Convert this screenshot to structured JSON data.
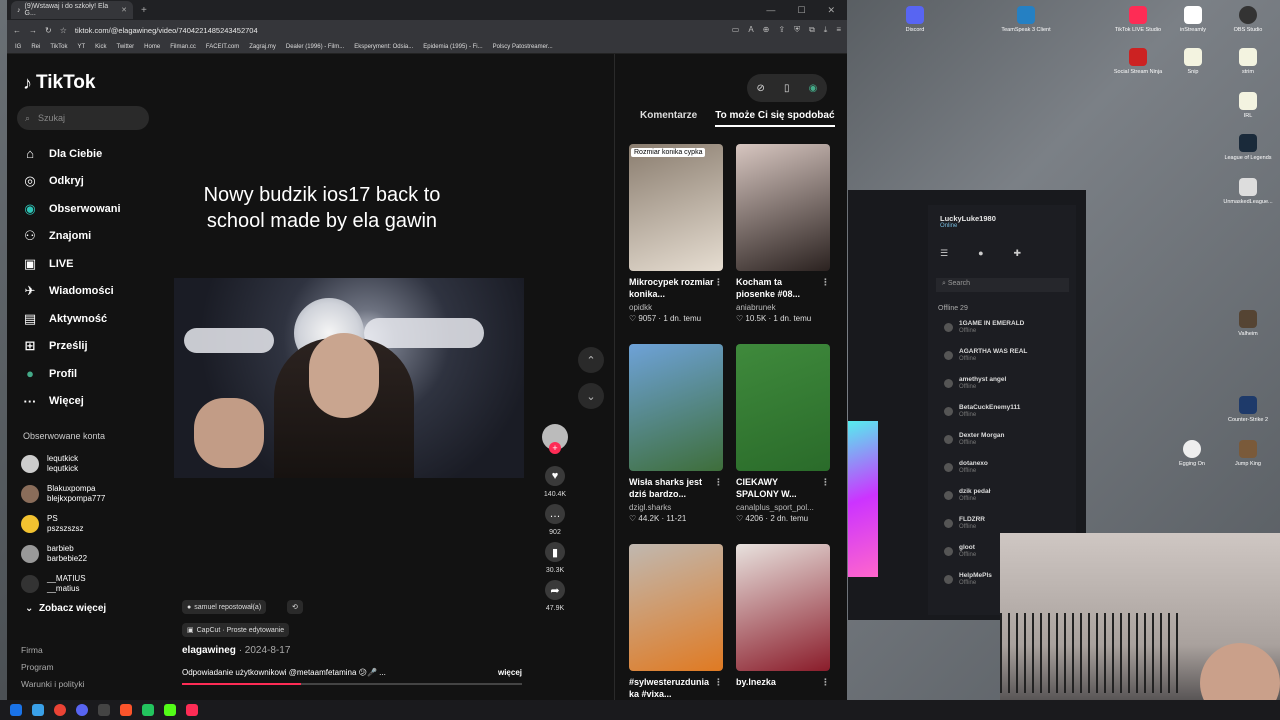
{
  "browser": {
    "tab_title": "(9)Wstawaj i do szkoły! Ela G...",
    "url": "tiktok.com/@elagawineg/video/7404221485243452704",
    "bookmarks": [
      "IG",
      "Rei",
      "TikTok",
      "YT",
      "Kick",
      "Twitter",
      "Home",
      "Filman.cc",
      "FACEIT.com",
      "Zagraj.my",
      "Dealer (1996) - Film...",
      "Eksperyment: Odsia...",
      "Epidemia (1995) - Fi...",
      "Polscy Patostreamer..."
    ]
  },
  "tiktok": {
    "logo": "TikTok",
    "search_placeholder": "Szukaj",
    "nav": [
      {
        "label": "Dla Ciebie",
        "icon": "home-icon"
      },
      {
        "label": "Odkryj",
        "icon": "compass-icon"
      },
      {
        "label": "Obserwowani",
        "icon": "following-icon"
      },
      {
        "label": "Znajomi",
        "icon": "friends-icon"
      },
      {
        "label": "LIVE",
        "icon": "live-icon"
      },
      {
        "label": "Wiadomości",
        "icon": "messages-icon"
      },
      {
        "label": "Aktywność",
        "icon": "activity-icon"
      },
      {
        "label": "Prześlij",
        "icon": "upload-icon"
      },
      {
        "label": "Profil",
        "icon": "profile-icon"
      },
      {
        "label": "Więcej",
        "icon": "more-icon"
      }
    ],
    "followed_header": "Obserwowane konta",
    "followed": [
      {
        "name": "lequtkick",
        "handle": "lequtkick"
      },
      {
        "name": "Blakuxpompa",
        "handle": "blejkxpompa777"
      },
      {
        "name": "PS",
        "handle": "pszszszsz"
      },
      {
        "name": "barbieb",
        "handle": "barbebie22"
      },
      {
        "name": "__MATIUS",
        "handle": "__matius"
      }
    ],
    "see_more": "Zobacz więcej",
    "footer": [
      "Firma",
      "Program",
      "Warunki i polityki"
    ],
    "video": {
      "title": "Nowy budzik ios17 back to school made by ela gawin",
      "repost_chip": "samuel repostował(a)",
      "capcut_chip": "CapCut · Proste edytowanie",
      "author": "elagawineg",
      "date": "· 2024-8-17",
      "caption": "Odpowiadanie użytkownikowi @metaamfetamina 😕🎤 ...",
      "more": "więcej",
      "progress": 0.35
    },
    "actions": {
      "likes": "140.4K",
      "comments": "902",
      "saves": "30.3K",
      "shares": "47.9K"
    },
    "tabs": [
      "Komentarze",
      "To może Ci się spodobać"
    ],
    "recommendations": [
      {
        "title": "Mikrocypek rozmiar konika...",
        "user": "opidkk",
        "likes": "9057",
        "age": "1 dn. temu",
        "badge": "Rozmiar konika cypka",
        "color1": "#8a7d6f",
        "color2": "#e6ddd1"
      },
      {
        "title": "Kocham ta piosenke #08...",
        "user": "aniabrunek",
        "likes": "10.5K",
        "age": "1 dn. temu",
        "badge": "",
        "color1": "#d7c6c0",
        "color2": "#2b2220"
      },
      {
        "title": "Wisła sharks jest dziś bardzo...",
        "user": "dzigl.sharks",
        "likes": "44.2K",
        "age": "11-21",
        "badge": "",
        "color1": "#6ea2d8",
        "color2": "#3e6e3a"
      },
      {
        "title": "CIEKAWY SPALONY W...",
        "user": "canalplus_sport_pol...",
        "likes": "4206",
        "age": "2 dn. temu",
        "badge": "",
        "color1": "#3f8a3c",
        "color2": "#2a6b2a"
      },
      {
        "title": "#sylwesteruzdunia ka #vixa...",
        "user": "",
        "likes": "",
        "age": "",
        "badge": "",
        "color1": "#c0b8b0",
        "color2": "#e07a22"
      },
      {
        "title": "by.lnezka",
        "user": "",
        "likes": "",
        "age": "",
        "badge": "",
        "color1": "#e8e2de",
        "color2": "#8a1c2a"
      }
    ]
  },
  "steam": {
    "username": "LuckyLuke1980",
    "status": "Online",
    "search_placeholder": "Search",
    "offline_label": "Offline 29",
    "friends": [
      "1GAME IN EMERALD",
      "AGARTHA WAS REAL",
      "amethyst angel",
      "BetaCuckEnemy111",
      "Dexter Morgan",
      "dotanexo",
      "dzik pedał",
      "FLDZRR",
      "gloot",
      "HelpMePls"
    ],
    "friend_status": "Offline"
  },
  "desktop_icons": [
    "Discord",
    "TeamSpeak 3 Client",
    "TikTok LIVE Studio",
    "inStreamly",
    "OBS Studio",
    "Social Stream Ninja",
    "Snip",
    "strim",
    "IRL",
    "League of Legends",
    "UnmaskedLeague...",
    "Valheim",
    "Counter-Strike 2",
    "Egging On",
    "Jump King"
  ]
}
